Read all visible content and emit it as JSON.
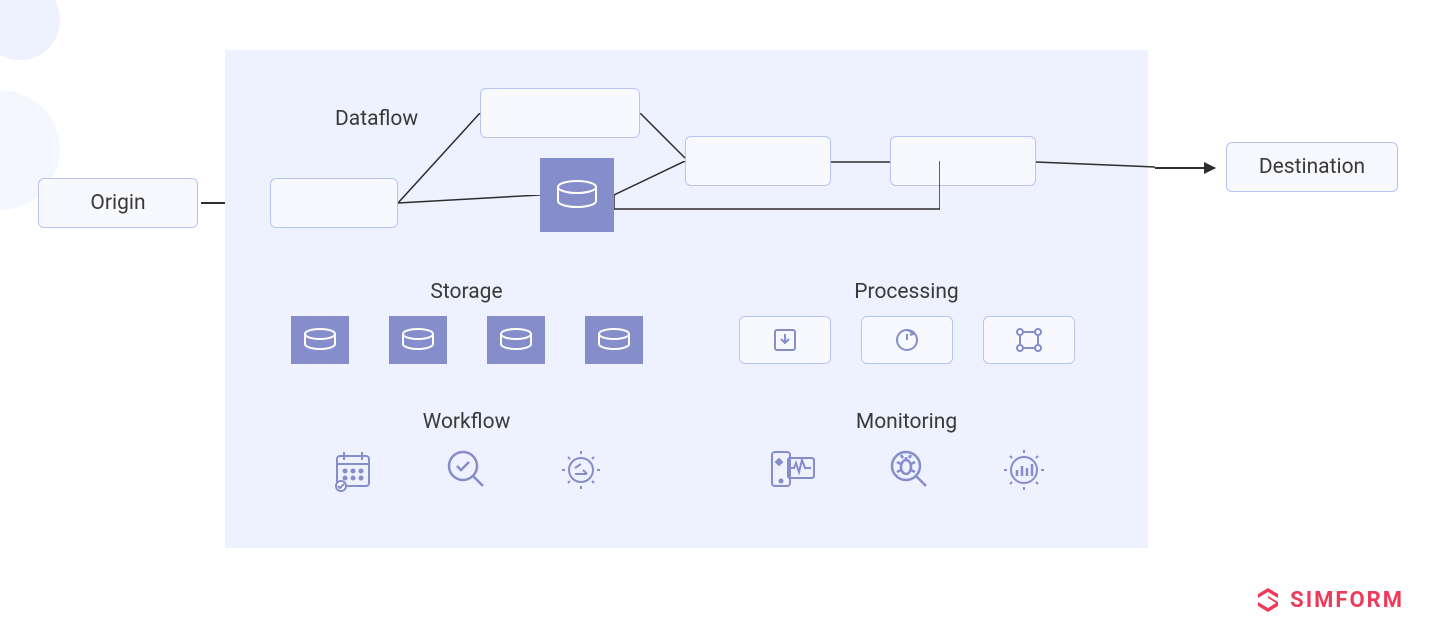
{
  "origin_label": "Origin",
  "destination_label": "Destination",
  "dataflow_title": "Dataflow",
  "storage_title": "Storage",
  "processing_title": "Processing",
  "workflow_title": "Workflow",
  "monitoring_title": "Monitoring",
  "brand": "SIMFORM",
  "colors": {
    "block_bg": "#eef1fe",
    "node_border": "#b9c4f5",
    "node_bg": "#f7f9ff",
    "disk_bg": "#858ecb",
    "icon_stroke": "#858ecb",
    "brand": "#ef3b5b"
  }
}
